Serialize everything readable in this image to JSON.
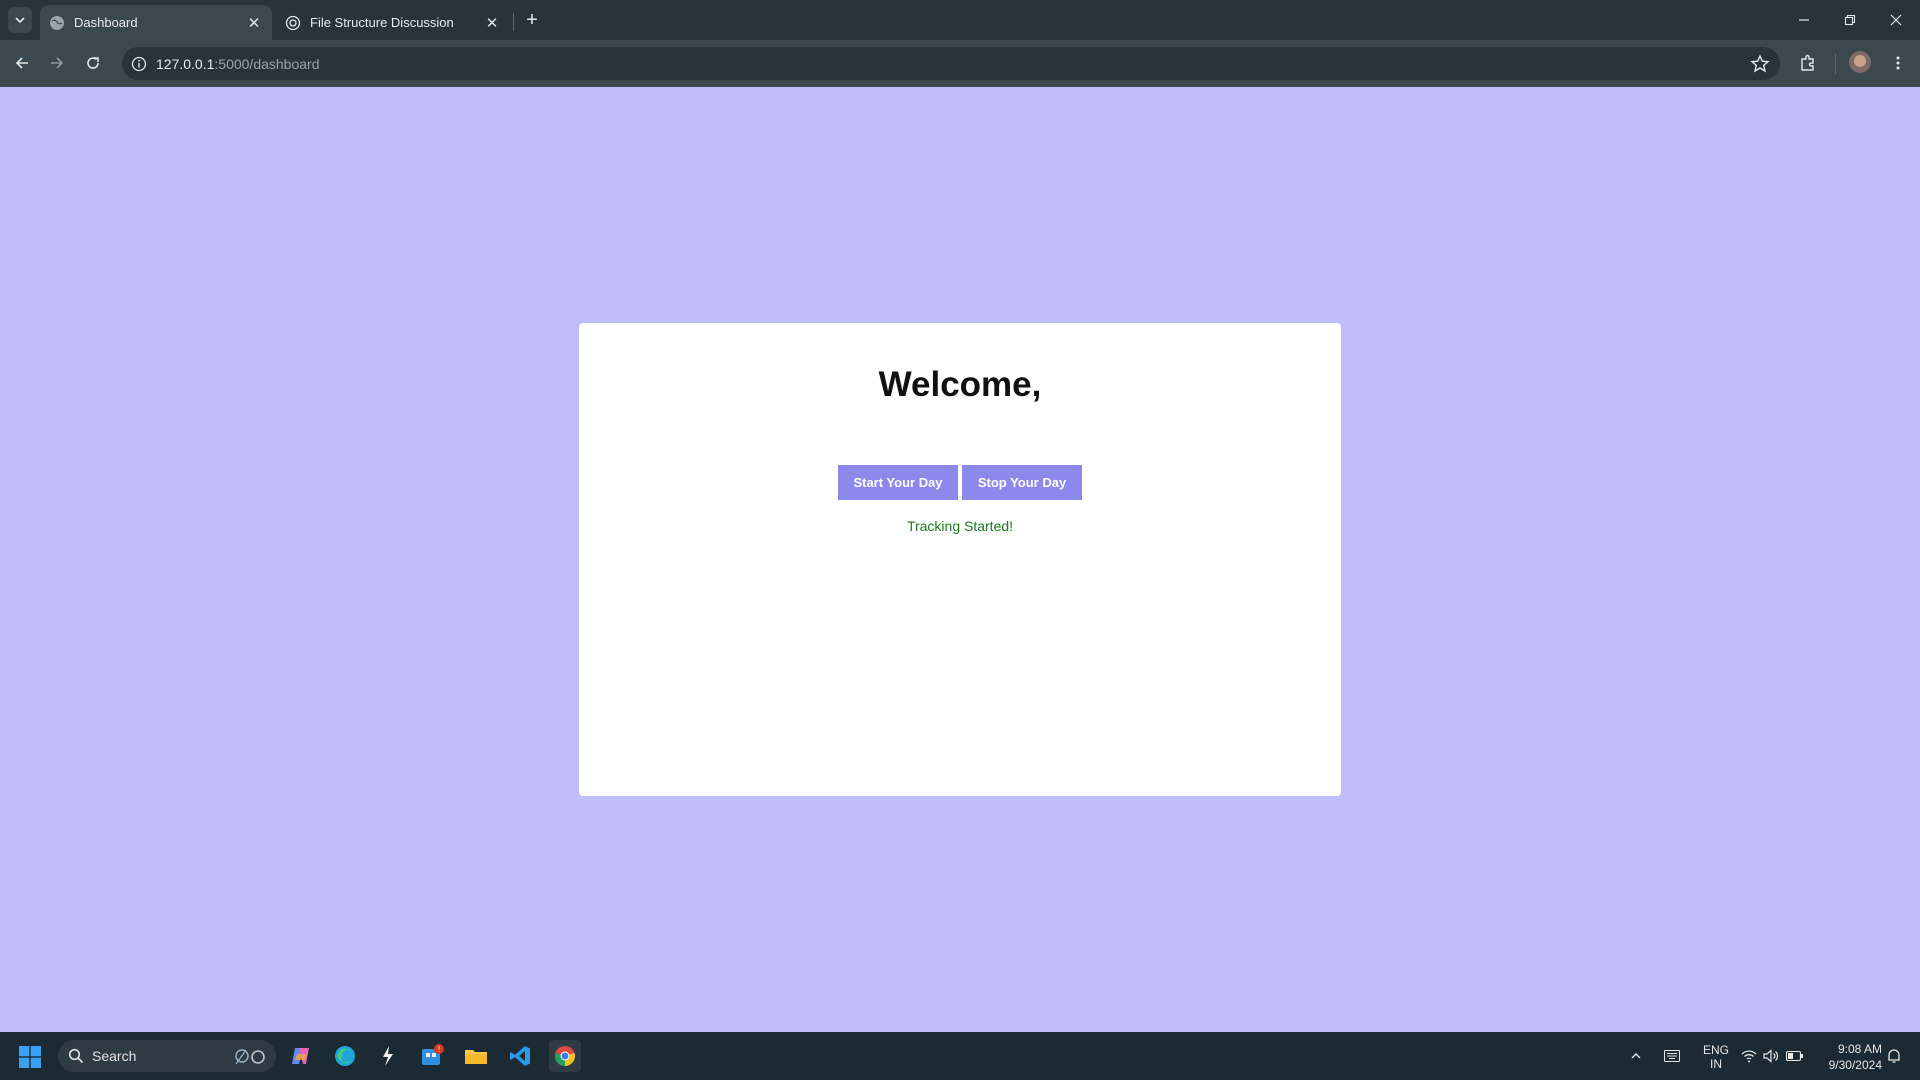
{
  "browser": {
    "tabs": [
      {
        "title": "Dashboard",
        "active": true,
        "favicon": "globe-icon"
      },
      {
        "title": "File Structure Discussion",
        "active": false,
        "favicon": "openai-icon"
      }
    ],
    "url_host": "127.0.0.1",
    "url_path": ":5000/dashboard"
  },
  "page": {
    "background": "#c0bdfd",
    "heading": "Welcome,",
    "start_button": "Start Your Day",
    "stop_button": "Stop Your Day",
    "status": "Tracking Started!",
    "button_color": "#8d89ea",
    "status_color": "#1f7a1f"
  },
  "taskbar": {
    "search_placeholder": "Search",
    "lang_line1": "ENG",
    "lang_line2": "IN",
    "time": "9:08 AM",
    "date": "9/30/2024",
    "notification_badge": "!"
  }
}
